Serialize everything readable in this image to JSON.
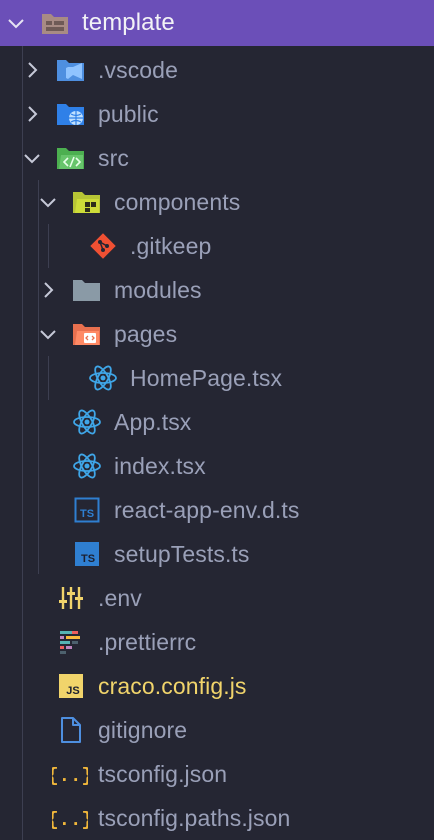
{
  "tree": {
    "root": "template",
    "vscode": ".vscode",
    "public": "public",
    "src": "src",
    "components": "components",
    "gitkeep": ".gitkeep",
    "modules": "modules",
    "pages": "pages",
    "homepage": "HomePage.tsx",
    "app": "App.tsx",
    "index": "index.tsx",
    "react_env": "react-app-env.d.ts",
    "setup_tests": "setupTests.ts",
    "env": ".env",
    "prettierrc": ".prettierrc",
    "craco": "craco.config.js",
    "gitignore": "gitignore",
    "tsconfig": "tsconfig.json",
    "tsconfig_paths": "tsconfig.paths.json"
  },
  "icons": {
    "ts_badge": "TS",
    "js_badge": "JS",
    "json_glyph": "{..}"
  },
  "colors": {
    "selection": "#6b4fb8",
    "react": "#3fa6e8",
    "ts": "#2f7fd1",
    "js": "#f1d46b",
    "git": "#f05033"
  }
}
